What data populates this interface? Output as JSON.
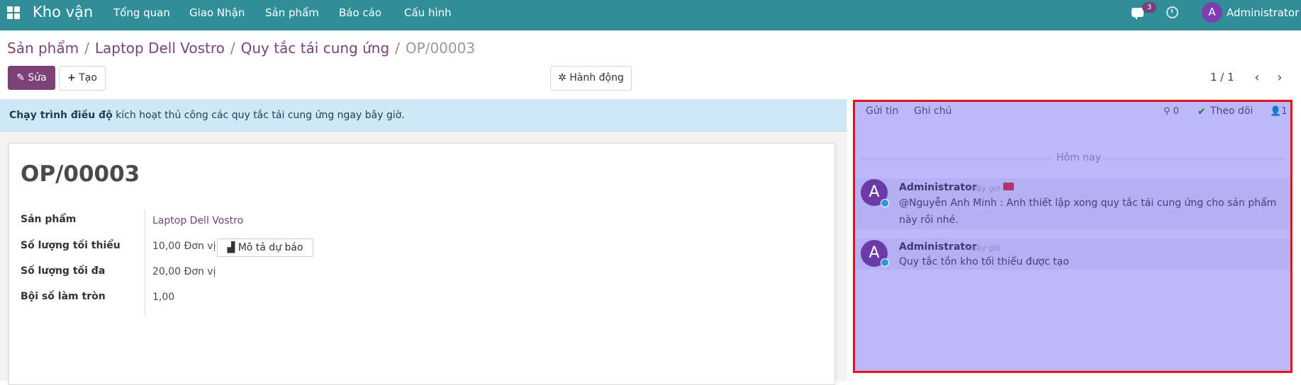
{
  "topbar": {
    "brand": "Kho vận",
    "menu": [
      "Tổng quan",
      "Giao Nhận",
      "Sản phẩm",
      "Báo cáo",
      "Cấu hình"
    ],
    "chat_badge": "3",
    "avatar_letter": "A",
    "user": "Administrator"
  },
  "breadcrumb": {
    "items": [
      "Sản phẩm",
      "Laptop Dell Vostro",
      "Quy tắc tái cung ứng"
    ],
    "separator": "/",
    "current": "OP/00003"
  },
  "toolbar": {
    "edit_label": "Sửa",
    "create_label": "Tạo",
    "action_label": "Hành động",
    "pager": "1 / 1"
  },
  "alert": {
    "bold": "Chạy trình điều độ",
    "rest": " kích hoạt thủ công các quy tắc tái cung ứng ngay bây giờ."
  },
  "record": {
    "title": "OP/00003",
    "fields": {
      "product_label": "Sản phẩm",
      "product_value": "Laptop Dell Vostro",
      "min_label": "Số lượng tối thiểu",
      "min_value": "10,00",
      "min_uom": "Đơn vị",
      "forecast_label": "Mô tả dự báo",
      "max_label": "Số lượng tối đa",
      "max_value": "20,00",
      "max_uom": "Đơn vị",
      "multiple_label": "Bội số làm tròn",
      "multiple_value": "1,00"
    }
  },
  "chatter": {
    "send_message": "Gửi tin",
    "log_note": "Ghi chú",
    "attachments": "0",
    "follow": "Theo dõi",
    "followers": "1",
    "today": "Hôm nay",
    "messages": [
      {
        "avatar": "A",
        "author": "Administrator",
        "time": "- bây giờ",
        "line1": "@Nguyễn Anh Minh : Anh thiết lập xong quy tắc tái cung ứng cho sản phẩm",
        "line2": "này rồi nhé."
      },
      {
        "avatar": "A",
        "author": "Administrator",
        "time": "- bây giờ",
        "line1": "Quy tắc tồn kho tối thiểu được tạo"
      }
    ]
  },
  "colors": {
    "topbar": "#308e99",
    "primary": "#7c4278",
    "chatter_overlay": "#bcb9f8",
    "highlight_border": "#e0161e"
  }
}
